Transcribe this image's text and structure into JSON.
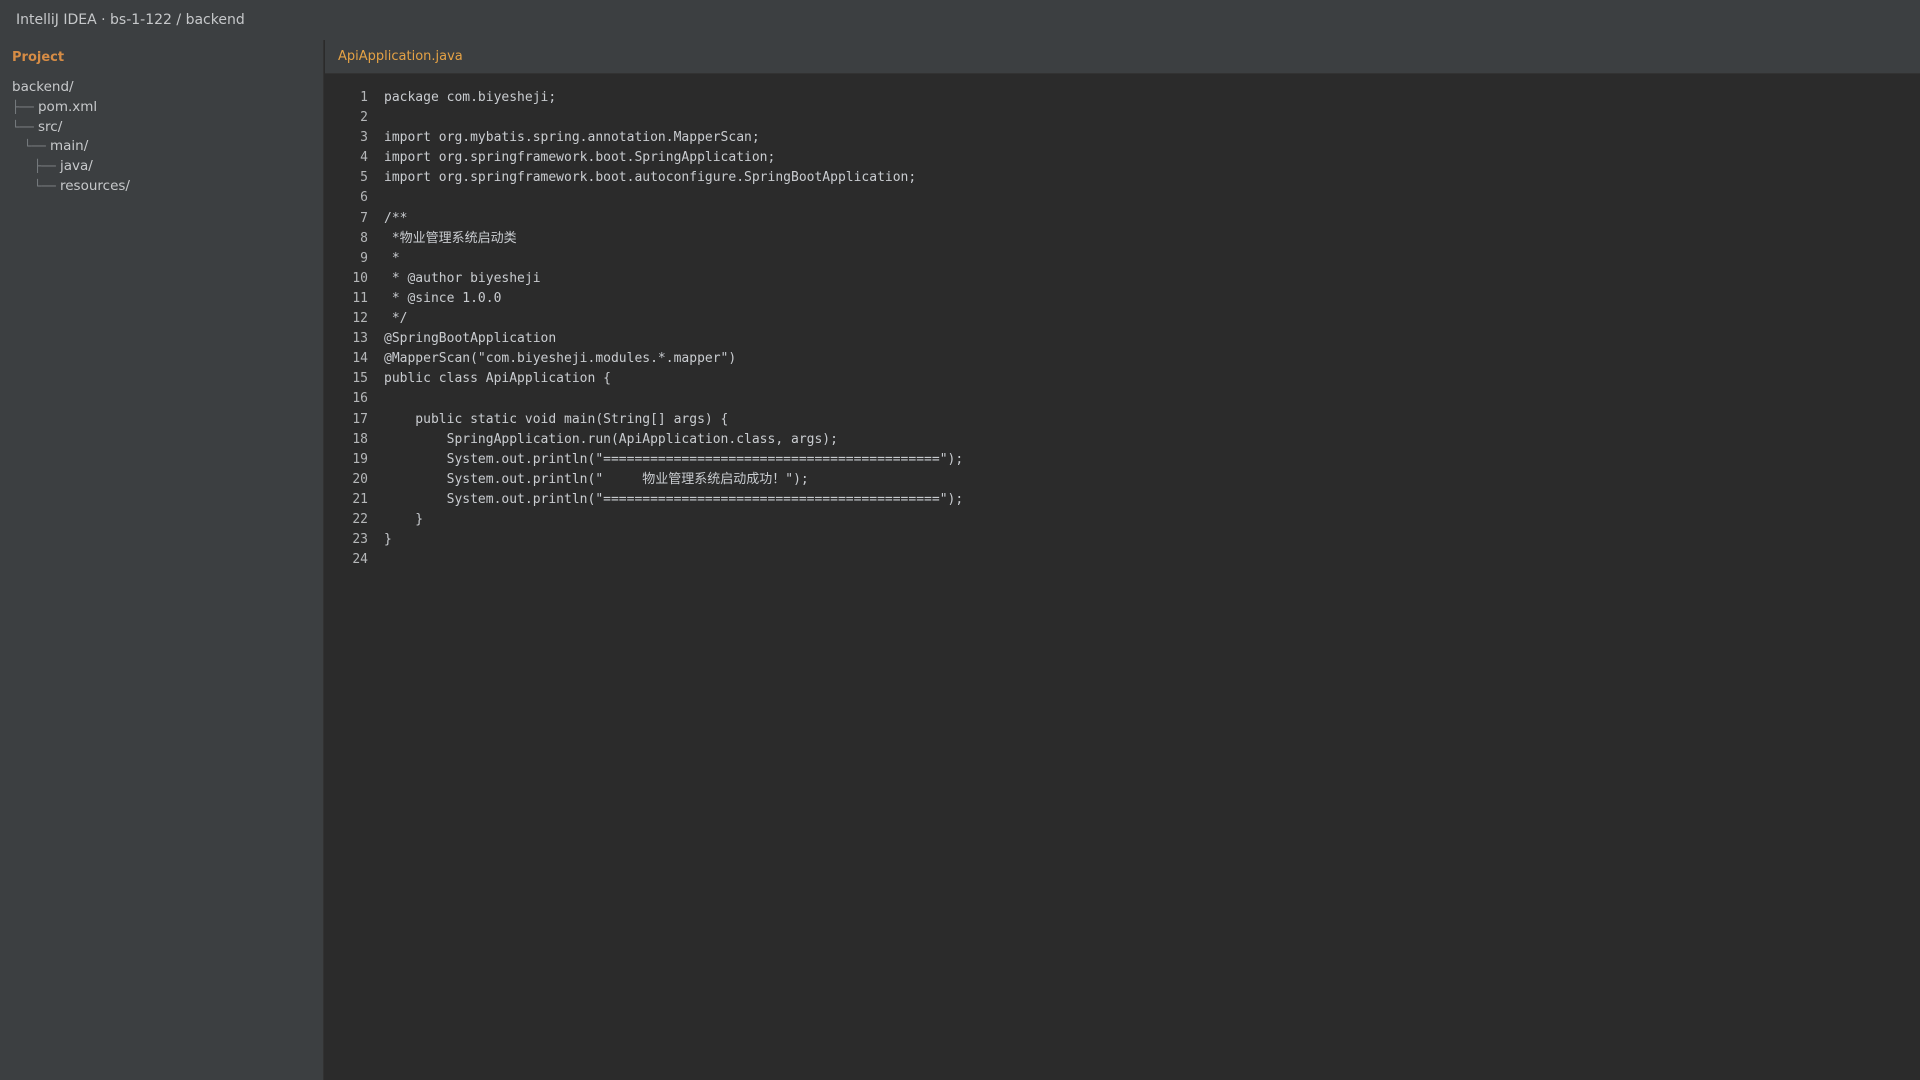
{
  "window": {
    "title": "IntelliJ IDEA · bs-1-122 / backend"
  },
  "sidebar": {
    "title": "Project",
    "tree": [
      {
        "guide": "",
        "label": "backend/"
      },
      {
        "guide": "├──",
        "label": "pom.xml"
      },
      {
        "guide": "└──",
        "label": "src/"
      },
      {
        "guide": "    └──",
        "label": "main/"
      },
      {
        "guide": "        ├──",
        "label": "java/"
      },
      {
        "guide": "        └──",
        "label": "resources/"
      }
    ]
  },
  "editor": {
    "tab": "ApiApplication.java",
    "lines": [
      "package com.biyesheji;",
      "",
      "import org.mybatis.spring.annotation.MapperScan;",
      "import org.springframework.boot.SpringApplication;",
      "import org.springframework.boot.autoconfigure.SpringBootApplication;",
      "",
      "/**",
      " *物业管理系统启动类",
      " *",
      " * @author biyesheji",
      " * @since 1.0.0",
      " */",
      "@SpringBootApplication",
      "@MapperScan(\"com.biyesheji.modules.*.mapper\")",
      "public class ApiApplication {",
      "",
      "    public static void main(String[] args) {",
      "        SpringApplication.run(ApiApplication.class, args);",
      "        System.out.println(\"===========================================\");",
      "        System.out.println(\"     物业管理系统启动成功！\");",
      "        System.out.println(\"===========================================\");",
      "    }",
      "}",
      ""
    ]
  }
}
